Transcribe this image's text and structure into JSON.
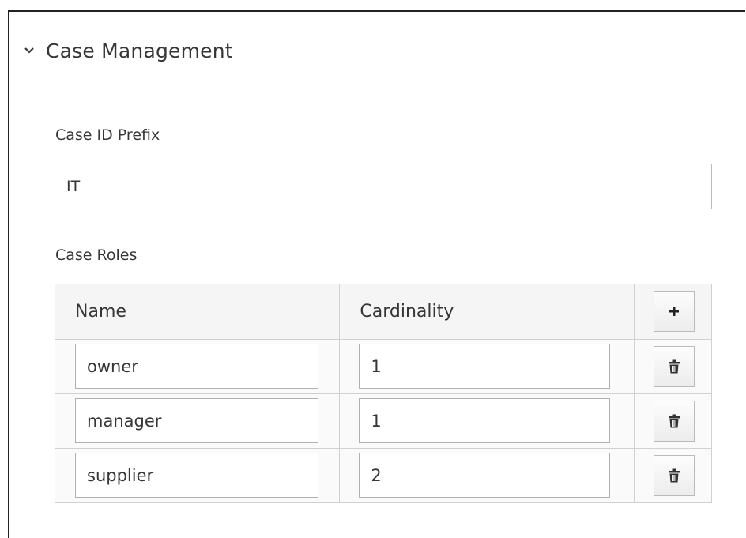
{
  "section": {
    "title": "Case Management",
    "icon": "chevron-down-icon"
  },
  "case_id_prefix": {
    "label": "Case ID Prefix",
    "value": "IT"
  },
  "case_roles": {
    "label": "Case Roles",
    "columns": {
      "name": "Name",
      "cardinality": "Cardinality"
    },
    "add_icon": "plus-icon",
    "delete_icon": "trash-icon",
    "rows": [
      {
        "name": "owner",
        "cardinality": "1"
      },
      {
        "name": "manager",
        "cardinality": "1"
      },
      {
        "name": "supplier",
        "cardinality": "2"
      }
    ]
  }
}
